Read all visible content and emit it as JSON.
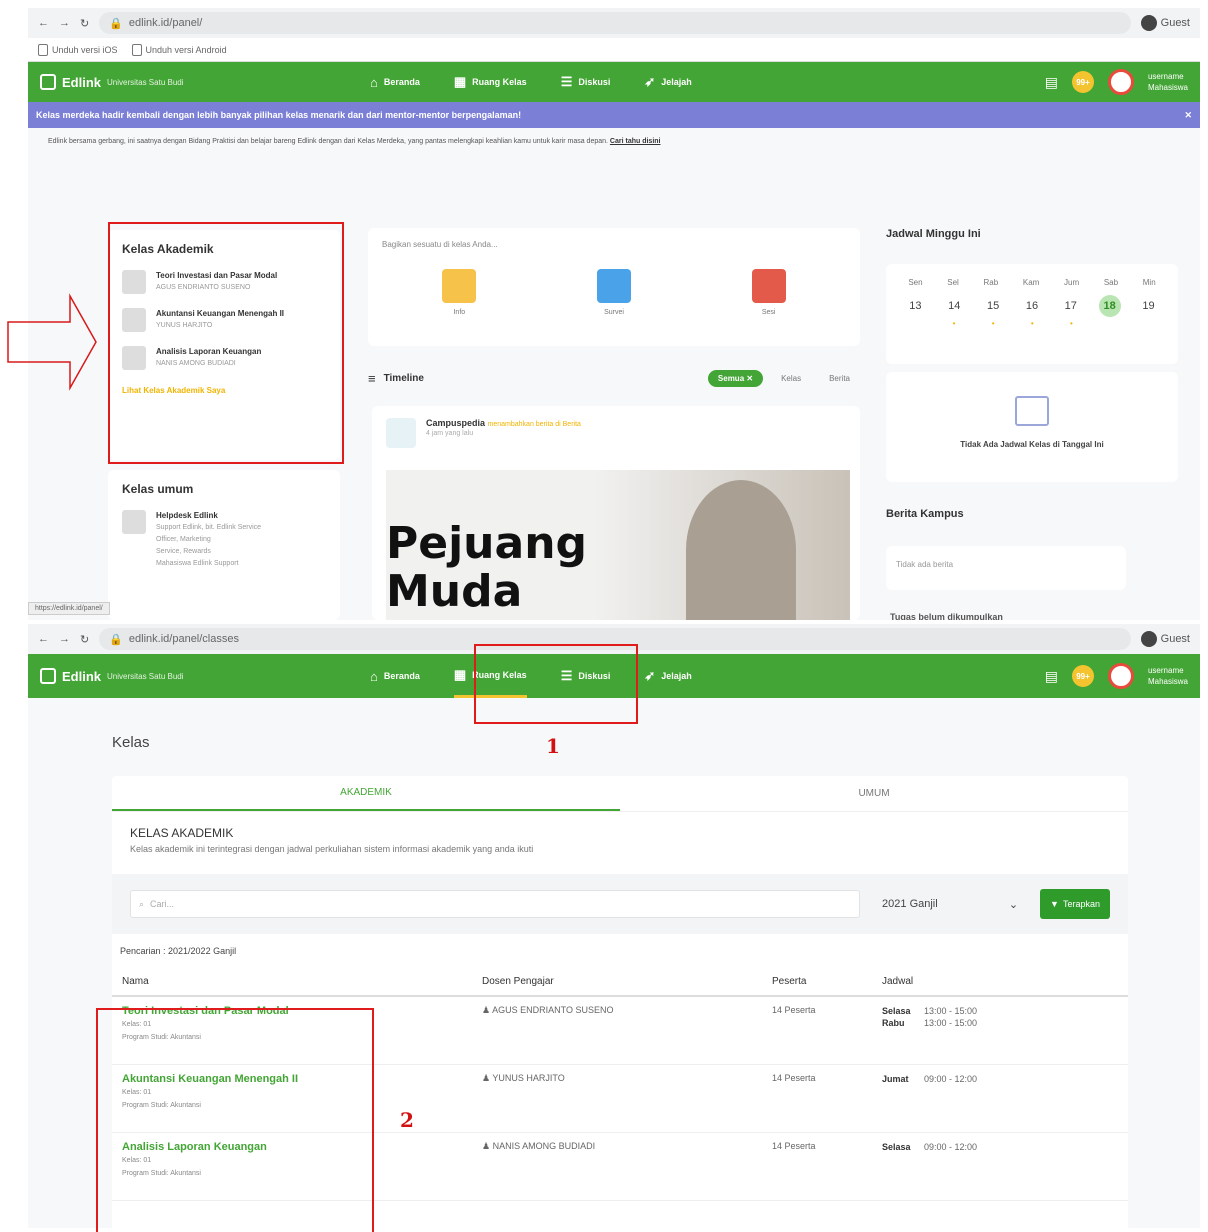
{
  "top": {
    "url": "edlink.id/panel/",
    "guest": "Guest",
    "bookmarks": [
      "Unduh versi iOS",
      "Unduh versi Android"
    ],
    "brand": "Edlink",
    "university": "Universitas Satu Budi",
    "nav": [
      "Beranda",
      "Ruang Kelas",
      "Diskusi",
      "Jelajah"
    ],
    "user_name": "username",
    "user_role": "Mahasiswa",
    "bell_count": "99+",
    "banner": "Kelas merdeka hadir kembali dengan lebih banyak pilihan kelas menarik dan dari mentor-mentor berpengalaman!",
    "notice_text": "Edlink bersama gerbang, ini saatnya dengan Bidang Praktisi dan belajar bareng Edlink dengan dari Kelas Merdeka, yang pantas melengkapi keahlian kamu untuk karir masa depan.",
    "notice_link": "Kelas Merdeka",
    "notice_link2": "Cari tahu disini",
    "kelas_akademik_title": "Kelas Akademik",
    "kelas_akademik": [
      {
        "title": "Teori Investasi dan Pasar Modal",
        "lecturer": "AGUS ENDRIANTO SUSENO"
      },
      {
        "title": "Akuntansi Keuangan Menengah II",
        "lecturer": "YUNUS HARJITO"
      },
      {
        "title": "Analisis Laporan Keuangan",
        "lecturer": "NANIS AMONG BUDIADI"
      }
    ],
    "lihat_link": "Lihat Kelas Akademik Saya",
    "kelas_umum_title": "Kelas umum",
    "kelas_umum": [
      {
        "title": "Helpdesk Edlink",
        "lines": [
          "Support Edlink, bit. Edlink Service",
          "Officer, Marketing",
          "Service, Rewards",
          "Mahasiswa Edlink Support"
        ]
      }
    ],
    "shortcuts_title": "Bagikan sesuatu di kelas Anda...",
    "shortcuts": [
      "Info",
      "Survei",
      "Sesi"
    ],
    "timeline_title": "Timeline",
    "timeline_filters": [
      "Semua",
      "Kelas",
      "Berita"
    ],
    "post_author": "Campuspedia",
    "post_action": "menambahkan berita di Berita",
    "post_time": "4 jam yang lalu",
    "post_image_text": "Pejuang\nMuda",
    "jadwal_title": "Jadwal Minggu Ini",
    "days": [
      "Sen",
      "Sel",
      "Rab",
      "Kam",
      "Jum",
      "Sab",
      "Min"
    ],
    "dates": [
      "13",
      "14",
      "15",
      "16",
      "17",
      "18",
      "19"
    ],
    "no_schedule": "Tidak Ada Jadwal Kelas di Tanggal Ini",
    "berita_title": "Berita Kampus",
    "no_news": "Tidak ada berita",
    "next_title": "Tugas belum dikumpulkan",
    "status_url": "https://edlink.id/panel/"
  },
  "bottom": {
    "url": "edlink.id/panel/classes",
    "page_title": "Kelas",
    "tabs": [
      "AKADEMIK",
      "UMUM"
    ],
    "section_title": "KELAS AKADEMIK",
    "section_desc": "Kelas akademik ini terintegrasi dengan jadwal perkuliahan sistem informasi akademik yang anda ikuti",
    "search_placeholder": "Cari...",
    "semester": "2021 Ganjil",
    "apply_button": "Terapkan",
    "filter_caption": "Pencarian : 2021/2022 Ganjil",
    "columns": [
      "Nama",
      "Dosen Pengajar",
      "Peserta",
      "Jadwal"
    ],
    "rows": [
      {
        "name": "Teori Investasi dan Pasar Modal",
        "kelas": "Kelas: 01",
        "prodi": "Program Studi: Akuntansi",
        "lecturer": "AGUS ENDRIANTO SUSENO",
        "peserta": "14 Peserta",
        "jadwal": [
          {
            "day": "Selasa",
            "time": "13:00 - 15:00"
          },
          {
            "day": "Rabu",
            "time": "13:00 - 15:00"
          }
        ]
      },
      {
        "name": "Akuntansi Keuangan Menengah II",
        "kelas": "Kelas: 01",
        "prodi": "Program Studi: Akuntansi",
        "lecturer": "YUNUS HARJITO",
        "peserta": "14 Peserta",
        "jadwal": [
          {
            "day": "Jumat",
            "time": "09:00 - 12:00"
          }
        ]
      },
      {
        "name": "Analisis Laporan Keuangan",
        "kelas": "Kelas: 01",
        "prodi": "Program Studi: Akuntansi",
        "lecturer": "NANIS AMONG BUDIADI",
        "peserta": "14 Peserta",
        "jadwal": [
          {
            "day": "Selasa",
            "time": "09:00 - 12:00"
          }
        ]
      }
    ]
  },
  "annotations": {
    "label_1": "1",
    "label_2": "2"
  }
}
